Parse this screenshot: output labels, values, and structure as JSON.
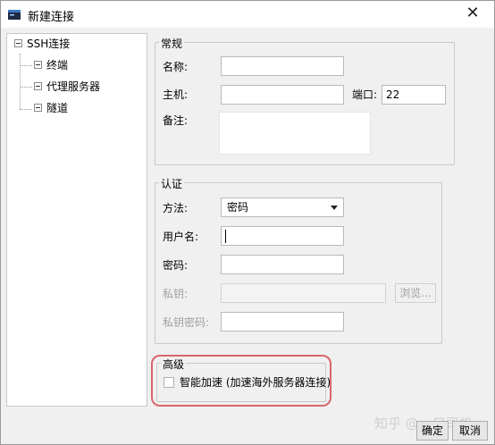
{
  "window": {
    "title": "新建连接",
    "close_glyph": "✕"
  },
  "tree": {
    "root": "SSH连接",
    "children": [
      "终端",
      "代理服务器",
      "隧道"
    ]
  },
  "general": {
    "legend": "常规",
    "name_label": "名称:",
    "name_value": "",
    "host_label": "主机:",
    "host_value": "",
    "port_label": "端口:",
    "port_value": "22",
    "note_label": "备注:",
    "note_value": ""
  },
  "auth": {
    "legend": "认证",
    "method_label": "方法:",
    "method_value": "密码",
    "username_label": "用户名:",
    "username_value": "",
    "password_label": "密码:",
    "password_value": "",
    "private_key_label": "私钥:",
    "private_key_value": "",
    "browse_label": "浏览...",
    "key_password_label": "私钥密码:",
    "key_password_value": ""
  },
  "advanced": {
    "legend": "高级",
    "smart_accel_label": "智能加速 (加速海外服务器连接)",
    "smart_accel_checked": false
  },
  "footer": {
    "ok_label": "确定",
    "cancel_label": "取消"
  },
  "watermark": "知乎 @一只司机",
  "colors": {
    "highlight": "#d9656b",
    "window_bg": "#f0f0f0"
  }
}
